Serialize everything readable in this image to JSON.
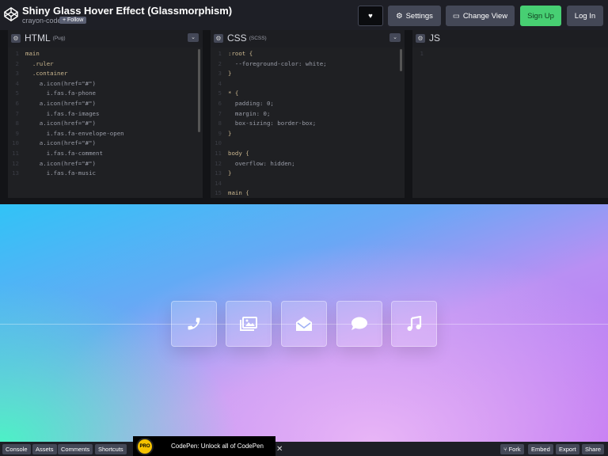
{
  "header": {
    "title": "Shiny Glass Hover Effect (Glassmorphism)",
    "author": "crayon-code",
    "follow": "+ Follow",
    "settings": "Settings",
    "change_view": "Change View",
    "sign_up": "Sign Up",
    "log_in": "Log In"
  },
  "editors": {
    "html": {
      "lang": "HTML",
      "sub": "(Pug)",
      "lines": [
        "main",
        "  .ruler",
        "  .container",
        "    a.icon(href=\"#\")",
        "      i.fas.fa-phone",
        "    a.icon(href=\"#\")",
        "      i.fas.fa-images",
        "    a.icon(href=\"#\")",
        "      i.fas.fa-envelope-open",
        "    a.icon(href=\"#\")",
        "      i.fas.fa-comment",
        "    a.icon(href=\"#\")",
        "      i.fas.fa-music"
      ]
    },
    "css": {
      "lang": "CSS",
      "sub": "(SCSS)",
      "lines": [
        ":root {",
        "  --foreground-color: white;",
        "}",
        "",
        "* {",
        "  padding: 0;",
        "  margin: 0;",
        "  box-sizing: border-box;",
        "}",
        "",
        "body {",
        "  overflow: hidden;",
        "}",
        "",
        "main {"
      ]
    },
    "js": {
      "lang": "JS",
      "lines": [
        ""
      ]
    }
  },
  "preview": {
    "icons": [
      "phone-icon",
      "images-icon",
      "envelope-open-icon",
      "comment-icon",
      "music-icon"
    ]
  },
  "footer": {
    "left": [
      "Console",
      "Assets",
      "Comments",
      "Shortcuts"
    ],
    "promo": "CodePen: Unlock all of CodePen",
    "promo_badge": "PRO",
    "right": [
      "Fork",
      "Embed",
      "Export",
      "Share"
    ]
  },
  "colors": {
    "accent_green": "#47cf73",
    "editor_bg": "#1d1e22"
  }
}
